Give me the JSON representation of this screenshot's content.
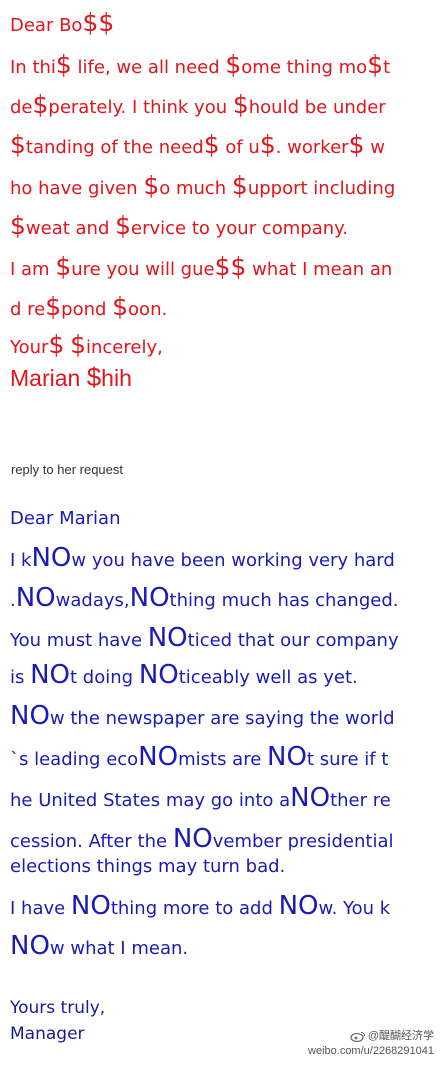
{
  "letter1": {
    "lines": [
      [
        "Dear Bo",
        "$$",
        ""
      ],
      [
        "In thi",
        "$",
        " life, we all need ",
        "$",
        "ome thing mo",
        "$",
        "t"
      ],
      [
        "de",
        "$",
        "perately. I think you ",
        "$",
        "hould be under"
      ],
      [
        "",
        "$",
        "tanding of the need",
        "$",
        " of u",
        "$",
        ". worker",
        "$",
        " w"
      ],
      [
        "ho have given ",
        "$",
        "o much ",
        "$",
        "upport including"
      ],
      [
        "",
        "$",
        "weat and ",
        "$",
        "ervice to your company."
      ],
      [
        "I am ",
        "$",
        "ure you will gue",
        "$$",
        " what I mean an"
      ],
      [
        "d re",
        "$",
        "pond ",
        "$",
        "oon."
      ],
      [
        "Your",
        "$",
        " ",
        "$",
        "incerely,"
      ]
    ],
    "signature": [
      "Marian ",
      "$",
      "hih"
    ]
  },
  "reply_label": "reply to her request",
  "letter2": {
    "lines": [
      [
        "Dear Marian"
      ],
      [
        "I k",
        "NO",
        "w you have been working very hard"
      ],
      [
        ".",
        "NO",
        "wadays,",
        "NO",
        "thing much has changed."
      ],
      [
        "You must have ",
        "NO",
        "ticed that our company"
      ],
      [
        "is ",
        "NO",
        "t doing ",
        "NO",
        "ticeably well as yet."
      ],
      [
        "",
        "NO",
        "w the newspaper are saying the world"
      ],
      [
        "`s leading eco",
        "NO",
        "mists are ",
        "NO",
        "t sure if t"
      ],
      [
        "he United States may go into a",
        "NO",
        "ther re"
      ],
      [
        "cession. After the ",
        "NO",
        "vember presidential"
      ],
      [
        "elections things may turn bad."
      ],
      [
        "I have ",
        "NO",
        "thing more to add ",
        "NO",
        "w. You k"
      ],
      [
        "",
        "NO",
        "w what I mean."
      ]
    ],
    "closing": [
      "Yours truly,",
      "Manager"
    ]
  },
  "watermark": {
    "handle": "@醍醐经济学",
    "url": "weibo.com/u/2268291041"
  },
  "colors": {
    "red": "#e3141a",
    "blue": "#1a1ab8"
  }
}
